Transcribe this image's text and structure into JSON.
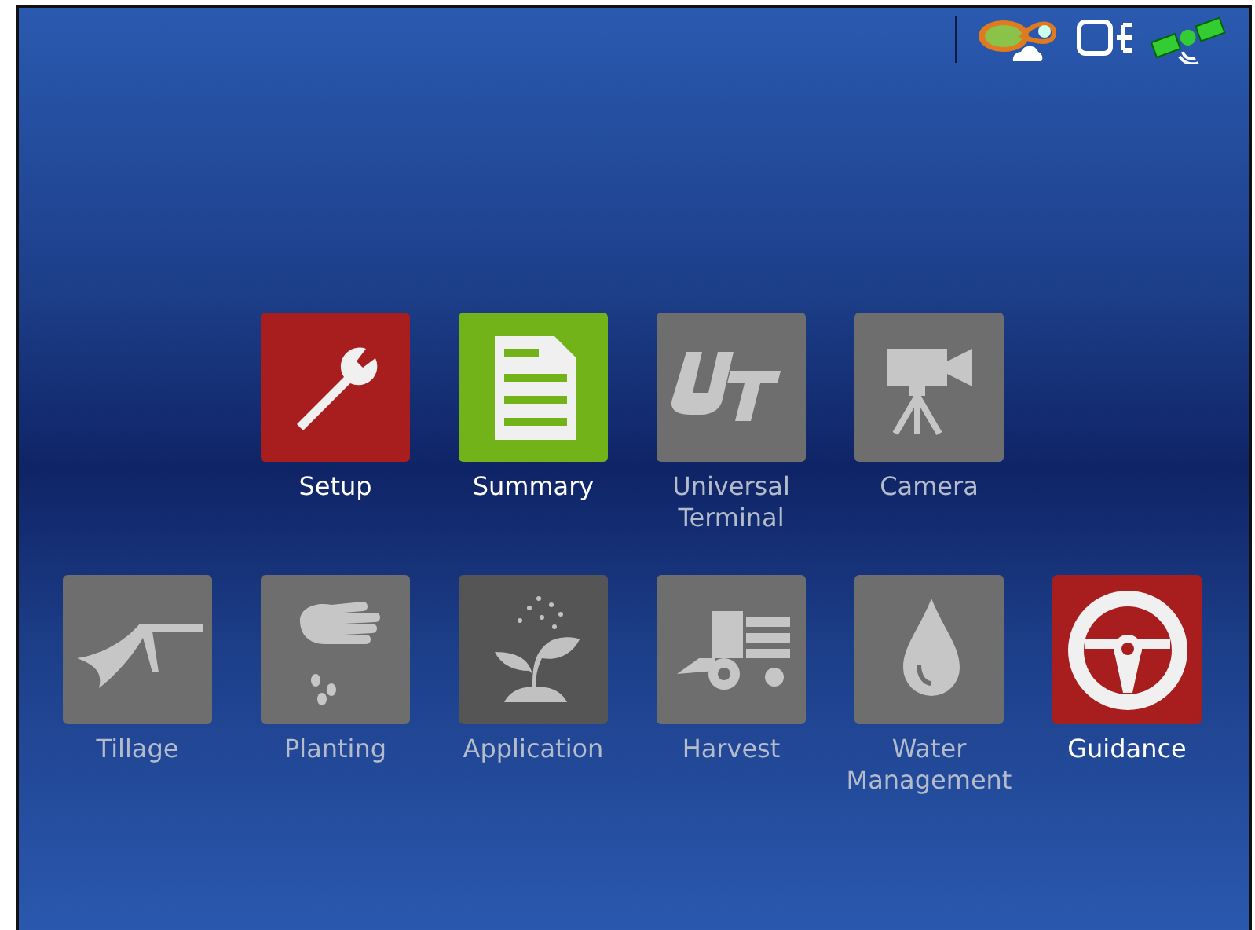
{
  "status_icons": [
    {
      "kind": "field"
    },
    {
      "kind": "display"
    },
    {
      "kind": "gps"
    }
  ],
  "apps": [
    {
      "kind": "setup",
      "label": "Setup",
      "enabled": true,
      "color": "#a81e1e"
    },
    {
      "kind": "summary",
      "label": "Summary",
      "enabled": true,
      "color": "#72b31a"
    },
    {
      "kind": "ut",
      "label": "Universal Terminal",
      "enabled": false,
      "color": "#6e6e6e"
    },
    {
      "kind": "camera",
      "label": "Camera",
      "enabled": false,
      "color": "#6e6e6e"
    },
    {
      "kind": "tillage",
      "label": "Tillage",
      "enabled": false,
      "color": "#6e6e6e"
    },
    {
      "kind": "planting",
      "label": "Planting",
      "enabled": false,
      "color": "#6e6e6e"
    },
    {
      "kind": "application",
      "label": "Application",
      "enabled": false,
      "color": "#555555"
    },
    {
      "kind": "harvest",
      "label": "Harvest",
      "enabled": false,
      "color": "#6e6e6e"
    },
    {
      "kind": "water",
      "label": "Water Management",
      "enabled": false,
      "color": "#6e6e6e"
    },
    {
      "kind": "guidance",
      "label": "Guidance",
      "enabled": true,
      "color": "#a81e1e"
    }
  ]
}
